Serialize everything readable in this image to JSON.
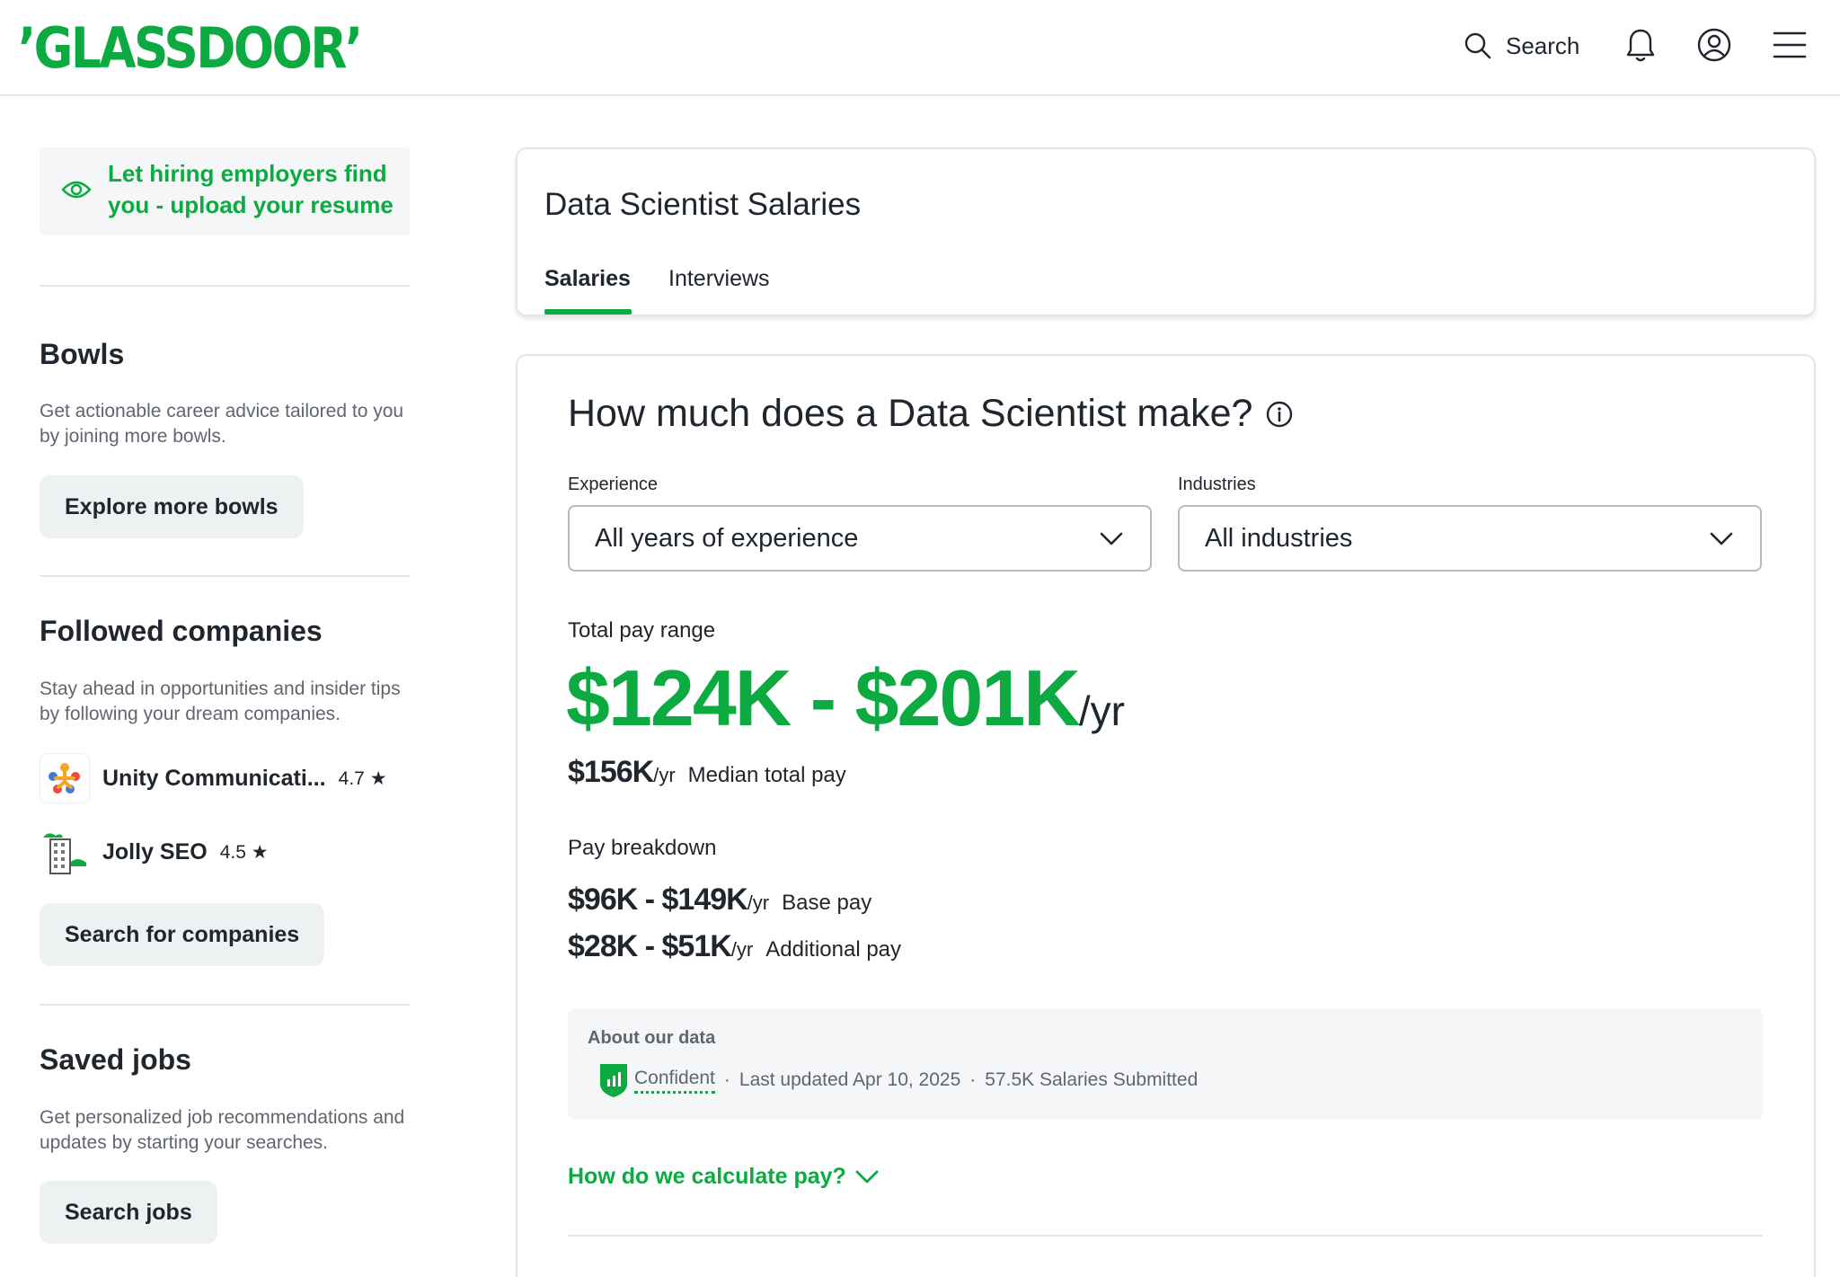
{
  "header": {
    "logo": "GLASSDOOR",
    "search_label": "Search",
    "icons": [
      "search-icon",
      "bell-icon",
      "user-icon",
      "menu-icon"
    ]
  },
  "sidebar": {
    "resume_text": "Let hiring employers find you - upload your resume",
    "bowls": {
      "heading": "Bowls",
      "description": "Get actionable career advice tailored to you by joining more bowls.",
      "button": "Explore more bowls"
    },
    "followed": {
      "heading": "Followed companies",
      "description": "Stay ahead in opportunities and insider tips by following your dream companies.",
      "companies": [
        {
          "name": "Unity Communicati...",
          "rating": "4.7",
          "star": "★"
        },
        {
          "name": "Jolly SEO",
          "rating": "4.5",
          "star": "★"
        }
      ],
      "button": "Search for companies"
    },
    "saved_jobs": {
      "heading": "Saved jobs",
      "description": "Get personalized job recommendations and updates by starting your searches.",
      "button": "Search jobs"
    }
  },
  "main": {
    "page_title": "Data Scientist Salaries",
    "tabs": [
      {
        "label": "Salaries",
        "active": true
      },
      {
        "label": "Interviews",
        "active": false
      }
    ],
    "question": "How much does a Data Scientist make?",
    "filters": {
      "experience_label": "Experience",
      "experience_value": "All years of experience",
      "industries_label": "Industries",
      "industries_value": "All industries"
    },
    "pay": {
      "range_label": "Total pay range",
      "range": "$124K - $201K",
      "unit": "/yr",
      "median_value": "$156K",
      "median_unit": "/yr",
      "median_label": "Median total pay"
    },
    "breakdown": {
      "label": "Pay breakdown",
      "rows": [
        {
          "value": "$96K - $149K",
          "unit": "/yr",
          "label": "Base pay"
        },
        {
          "value": "$28K - $51K",
          "unit": "/yr",
          "label": "Additional pay"
        }
      ]
    },
    "about": {
      "title": "About our data",
      "confidence": "Confident",
      "separator": "·",
      "updated": "Last updated Apr 10, 2025",
      "submitted": "57.5K Salaries Submitted"
    },
    "calc_link": "How do we calculate pay?"
  },
  "colors": {
    "brand_green": "#0caa41",
    "text": "#20262e",
    "muted": "#5f6670",
    "border": "#e3e5e8"
  }
}
